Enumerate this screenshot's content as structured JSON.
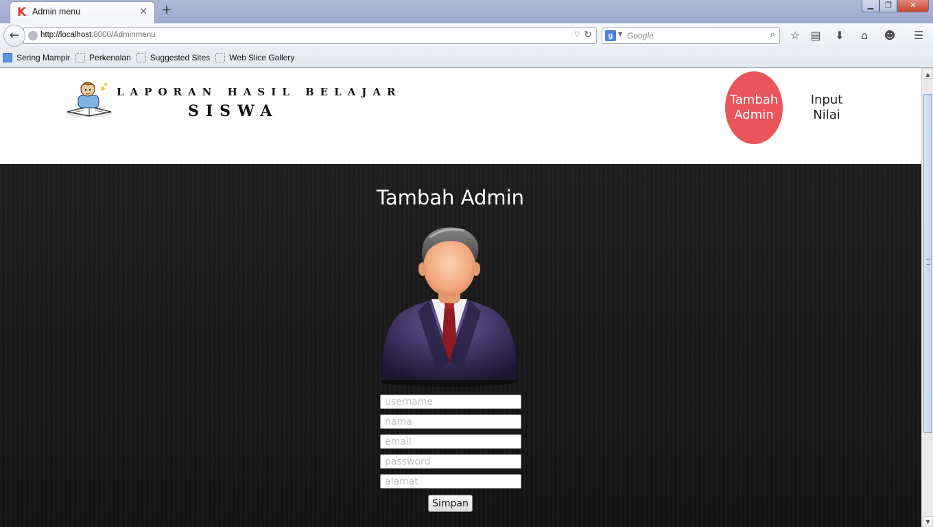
{
  "browser": {
    "tab_title": "Admin menu",
    "tab_favicon": "K",
    "url_host": "http://localhost",
    "url_rest": ":8000/Adminmenu",
    "search_placeholder": "Google",
    "search_engine_glyph": "g",
    "bookmarks": [
      {
        "label": "Sering Mampir",
        "icon": "most-visited-icon"
      },
      {
        "label": "Perkenalan",
        "icon": "page-icon"
      },
      {
        "label": "Suggested Sites",
        "icon": "page-icon"
      },
      {
        "label": "Web Slice Gallery",
        "icon": "page-icon"
      }
    ],
    "toolbar_icons": [
      "star-icon",
      "reading-list-icon",
      "download-icon",
      "home-icon",
      "chat-icon",
      "menu-icon"
    ]
  },
  "header": {
    "brand_line1": "LAPORAN HASIL BELAJAR",
    "brand_line2": "SISWA",
    "nav": {
      "admin_line1": "Tambah",
      "admin_line2": "Admin",
      "nilai_line1": "Input",
      "nilai_line2": "Nilai"
    },
    "accent_color": "#e9555a"
  },
  "form": {
    "title": "Tambah Admin",
    "fields": [
      {
        "name": "username",
        "placeholder": "username"
      },
      {
        "name": "nama",
        "placeholder": "nama"
      },
      {
        "name": "email",
        "placeholder": "email"
      },
      {
        "name": "password",
        "placeholder": "password"
      },
      {
        "name": "alamat",
        "placeholder": "alamat"
      }
    ],
    "submit_label": "Simpan"
  }
}
